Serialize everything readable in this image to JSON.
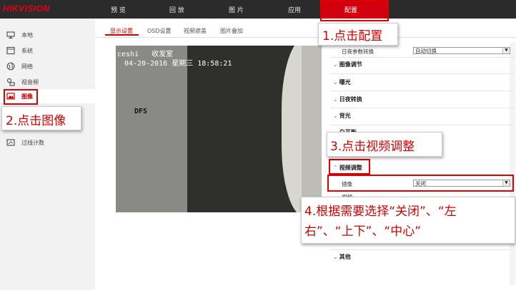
{
  "header": {
    "logo": "HIKVISION",
    "nav": [
      {
        "label": "预 览"
      },
      {
        "label": "回 放"
      },
      {
        "label": "图 片"
      },
      {
        "label": "应用"
      },
      {
        "label": "配置"
      }
    ]
  },
  "sidebar": {
    "items": [
      {
        "label": "本地",
        "icon": "monitor-icon"
      },
      {
        "label": "系统",
        "icon": "system-icon"
      },
      {
        "label": "网络",
        "icon": "globe-icon"
      },
      {
        "label": "视音频",
        "icon": "audio-video-icon"
      },
      {
        "label": "图像",
        "icon": "image-icon",
        "active": true
      },
      {
        "label": "过线计数",
        "icon": "counting-icon"
      }
    ]
  },
  "subtabs": [
    {
      "label": "显示设置",
      "active": true
    },
    {
      "label": "OSD设置"
    },
    {
      "label": "视频遮盖"
    },
    {
      "label": "图片叠加"
    }
  ],
  "video": {
    "osd_name": "ceshi   收发室",
    "osd_time": "04-20-2016 星期三 18:58:21",
    "osd_dfs": "DFS"
  },
  "panel": {
    "day_night_label": "日夜参数转换",
    "day_night_value": "自动切换",
    "sections": {
      "image_adjust": "图像调节",
      "exposure": "曝光",
      "day_night_switch": "日夜转换",
      "backlight": "背光",
      "white_balance": "白平衡",
      "video_adjust": "视频调整",
      "other": "其他"
    },
    "mirror_label": "镜像",
    "mirror_value": "关闭",
    "hidden_label": "视频",
    "hidden_value": "关闭"
  },
  "callouts": {
    "step1": "1.点击配置",
    "step2": "2.点击图像",
    "step3": "3.点击视频调整",
    "step4_line1": "4.根据需要选择“关闭”、“左",
    "step4_line2": "右”、“上下”、“中心”"
  },
  "colors": {
    "brand_red": "#d2000f",
    "callout_text": "#d40000",
    "topbar": "#2b2b2b"
  }
}
